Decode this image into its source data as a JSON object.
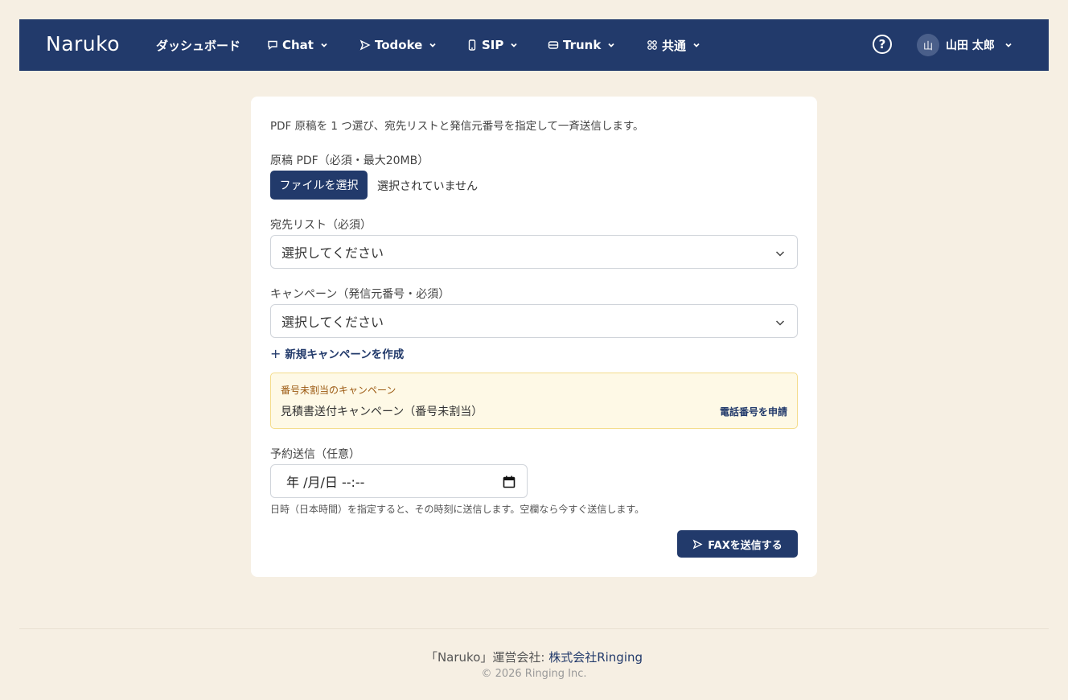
{
  "header": {
    "brand": "Naruko",
    "nav": [
      {
        "label": "ダッシュボード",
        "icon": "none"
      },
      {
        "label": "Chat",
        "icon": "chat-bubble-icon"
      },
      {
        "label": "Todoke",
        "icon": "send-icon"
      },
      {
        "label": "SIP",
        "icon": "phone-icon"
      },
      {
        "label": "Trunk",
        "icon": "server-icon"
      },
      {
        "label": "共通",
        "icon": "grid-icon"
      }
    ],
    "help_label": "?",
    "user": {
      "initial": "山",
      "name": "山田 太郎"
    }
  },
  "form": {
    "intro": "PDF 原稿を 1 つ選び、宛先リストと発信元番号を指定して一斉送信します。",
    "pdf_label": "原稿 PDF（必須・最大20MB）",
    "file_button": "ファイルを選択",
    "file_status": "選択されていません",
    "recipients_label": "宛先リスト（必須）",
    "recipients_value": "選択してください",
    "campaign_label": "キャンペーン（発信元番号・必須）",
    "campaign_value": "選択してください",
    "new_campaign": "新規キャンペーンを作成",
    "warning": {
      "title": "番号未割当のキャンペーン",
      "name": "見積書送付キャンペーン（番号未割当）",
      "link": "電話番号を申請"
    },
    "schedule_label": "予約送信（任意）",
    "schedule_value": "年 /月/日 --:--",
    "schedule_hint": "日時（日本時間）を指定すると、その時刻に送信します。空欄なら今すぐ送信します。",
    "submit": "FAXを送信する"
  },
  "footer": {
    "prefix": "「Naruko」運営会社: ",
    "company": "株式会社Ringing",
    "copyright": "© 2026 Ringing Inc."
  },
  "colors": {
    "navy": "#223a6b",
    "background": "#f6efe3",
    "warning_bg": "#fef9e6",
    "warning_title": "#9c5a12"
  }
}
